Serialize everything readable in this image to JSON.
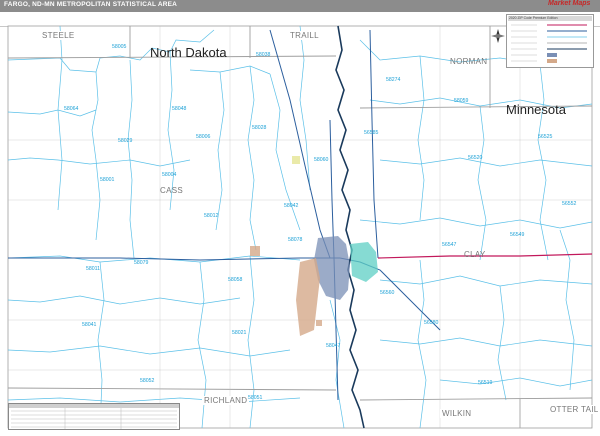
{
  "title": "FARGO, ND-MN METROPOLITAN STATISTICAL AREA",
  "edition": "2020 ZIP Code Premium Edition",
  "logo_text": "Market Maps",
  "states": [
    "North Dakota",
    "Minnesota"
  ],
  "counties": [
    "STEELE",
    "TRAILL",
    "NORMAN",
    "CASS",
    "CLAY",
    "RICHLAND",
    "WILKIN",
    "OTTER TAIL"
  ],
  "zip_codes": [
    "58005",
    "58038",
    "58274",
    "58064",
    "58048",
    "58029",
    "58006",
    "58028",
    "58059",
    "56585",
    "56525",
    "56520",
    "58060",
    "58001",
    "58004",
    "58012",
    "58042",
    "56552",
    "58078",
    "56547",
    "56549",
    "58011",
    "58079",
    "58058",
    "56560",
    "56580",
    "58021",
    "58041",
    "58047",
    "58052",
    "58051",
    "56519"
  ],
  "colors": {
    "title_bar": "#8c8c8c",
    "zip_boundary": "#5bc0e8",
    "zip_label": "#1da1d6",
    "county_line": "#9e9e9e",
    "river": "#1a3a5c",
    "highway": "#2c5f9e",
    "interstate": "#c2185b",
    "urban_fargo": "#7a8fb5",
    "urban_moorhead": "#5ecfc4",
    "urban_westfargo": "#d4a98a"
  }
}
